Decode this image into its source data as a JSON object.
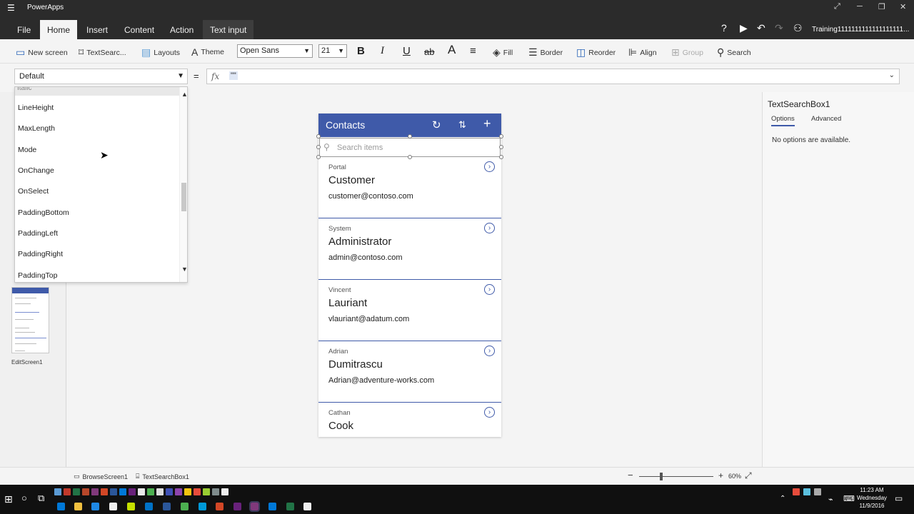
{
  "window": {
    "title": "PowerApps"
  },
  "ribbon": {
    "tabs": [
      "File",
      "Home",
      "Insert",
      "Content",
      "Action",
      "Text input"
    ],
    "user": "Training1111111111111111111..."
  },
  "toolbar": {
    "new_screen": "New screen",
    "text_search": "TextSearc...",
    "layouts": "Layouts",
    "theme": "Theme",
    "font": "Open Sans",
    "font_size": "21",
    "fill": "Fill",
    "border": "Border",
    "reorder": "Reorder",
    "align": "Align",
    "group": "Group",
    "search": "Search"
  },
  "formula": {
    "property": "Default",
    "equals": "=",
    "fx": "fx",
    "value": "\"\""
  },
  "dropdown": {
    "cut_item": "Italic",
    "items": [
      "LineHeight",
      "MaxLength",
      "Mode",
      "OnChange",
      "OnSelect",
      "PaddingBottom",
      "PaddingLeft",
      "PaddingRight",
      "PaddingTop"
    ]
  },
  "left_pane": {
    "thumbnail_label": "EditScreen1"
  },
  "app": {
    "title": "Contacts",
    "search_placeholder": "Search items",
    "records": [
      {
        "sub": "Portal",
        "name": "Customer",
        "email": "customer@contoso.com"
      },
      {
        "sub": "System",
        "name": "Administrator",
        "email": "admin@contoso.com"
      },
      {
        "sub": "Vincent",
        "name": "Lauriant",
        "email": "vlauriant@adatum.com"
      },
      {
        "sub": "Adrian",
        "name": "Dumitrascu",
        "email": "Adrian@adventure-works.com"
      },
      {
        "sub": "Cathan",
        "name": "Cook",
        "email": ""
      }
    ]
  },
  "right_pane": {
    "control": "TextSearchBox1",
    "tabs": [
      "Options",
      "Advanced"
    ],
    "message": "No options are available."
  },
  "status": {
    "screen": "BrowseScreen1",
    "control": "TextSearchBox1",
    "zoom": "60%",
    "zoom_level": 0.3
  },
  "clock": {
    "time": "11:23 AM",
    "day": "Wednesday",
    "date": "11/9/2016"
  },
  "colors": {
    "accent": "#3f5aa9",
    "ribbon_bg": "#2b2b2b",
    "taskbar_bg": "#101010"
  }
}
